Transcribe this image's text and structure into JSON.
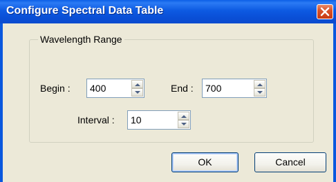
{
  "window": {
    "title": "Configure Spectral Data Table"
  },
  "group": {
    "legend": "Wavelength Range"
  },
  "fields": {
    "begin": {
      "label": "Begin :",
      "value": "400"
    },
    "end": {
      "label": "End :",
      "value": "700"
    },
    "interval": {
      "label": "Interval :",
      "value": "10"
    }
  },
  "buttons": {
    "ok": "OK",
    "cancel": "Cancel"
  },
  "icons": {
    "close": "close-icon",
    "spin_up": "up-arrow-icon",
    "spin_down": "down-arrow-icon"
  },
  "colors": {
    "titlebar": "#0a58de",
    "dialog_face": "#ece9d8",
    "close_button": "#d9522a",
    "input_border": "#7f9db9"
  }
}
